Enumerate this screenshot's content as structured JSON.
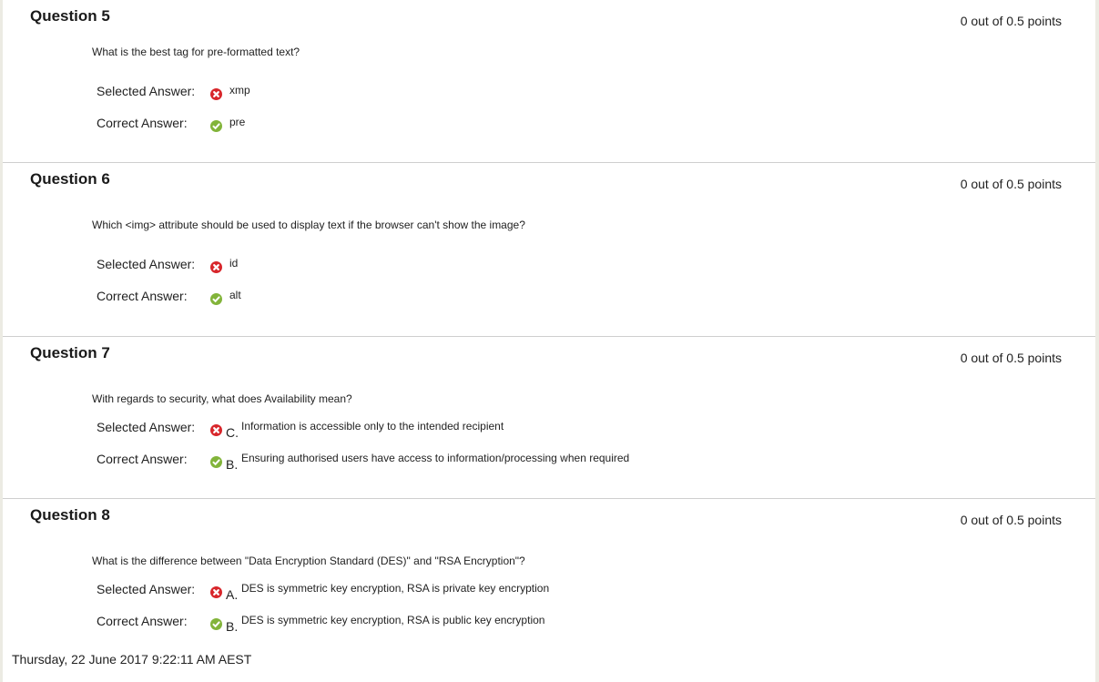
{
  "questions": [
    {
      "title": "Question 5",
      "points": "0 out of 0.5 points",
      "text": "What is the best tag for pre-formatted text?",
      "selected_label": "Selected Answer:",
      "selected_letter": "",
      "selected": "xmp",
      "correct_label": "Correct Answer:",
      "correct_letter": "",
      "correct": "pre"
    },
    {
      "title": "Question 6",
      "points": "0 out of 0.5 points",
      "text": "Which <img> attribute should be used to display text if the browser can't show the image?",
      "selected_label": "Selected Answer:",
      "selected_letter": "",
      "selected": "id",
      "correct_label": "Correct Answer:",
      "correct_letter": "",
      "correct": "alt"
    },
    {
      "title": "Question 7",
      "points": "0 out of 0.5 points",
      "text": "With regards to security, what does Availability mean?",
      "selected_label": "Selected Answer:",
      "selected_letter": "C.",
      "selected": "Information is accessible only to the intended recipient",
      "correct_label": "Correct Answer:",
      "correct_letter": "B.",
      "correct": "Ensuring authorised users have access to information/processing when required"
    },
    {
      "title": "Question 8",
      "points": "0 out of 0.5 points",
      "text": "What is the difference between \"Data Encryption Standard (DES)\" and \"RSA Encryption\"?",
      "selected_label": "Selected Answer:",
      "selected_letter": "A.",
      "selected": "DES is symmetric key encryption, RSA is private key encryption",
      "correct_label": "Correct Answer:",
      "correct_letter": "B.",
      "correct": "DES is symmetric key encryption, RSA is public key encryption"
    }
  ],
  "icons": {
    "incorrect": "x-circle-icon",
    "correct": "check-circle-icon"
  },
  "colors": {
    "incorrect": "#d8262b",
    "correct": "#82b43a"
  },
  "footer": {
    "timestamp": "Thursday, 22 June 2017 9:22:11 AM AEST"
  }
}
